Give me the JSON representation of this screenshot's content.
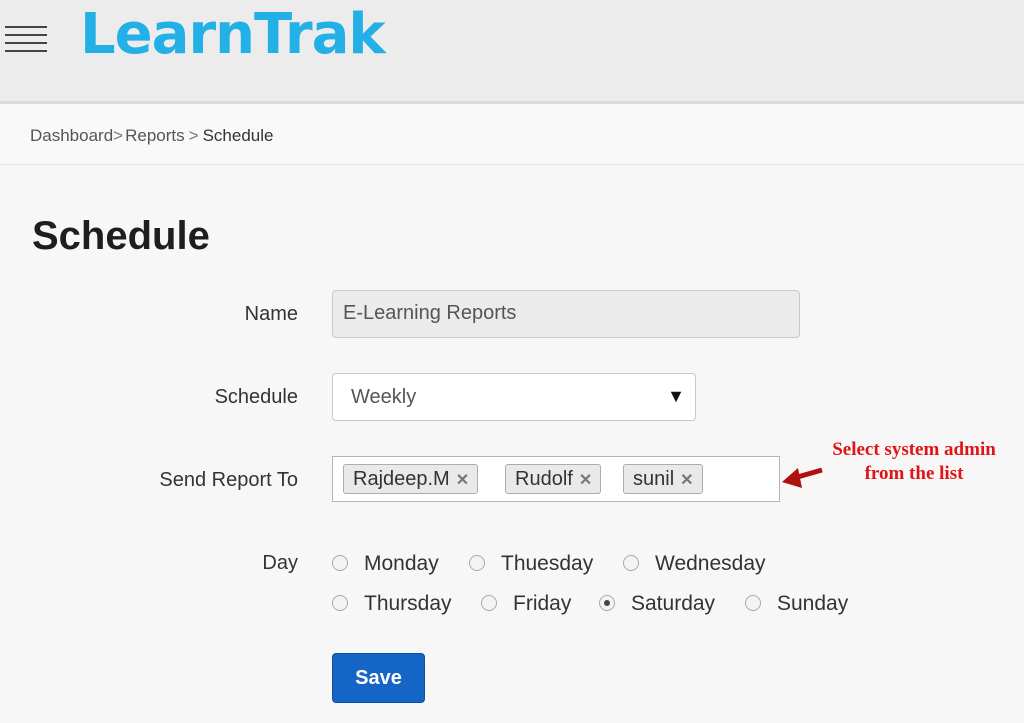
{
  "header": {
    "logo_text": "LearnTrak",
    "menu_icon": "hamburger-menu-icon"
  },
  "breadcrumb": {
    "items": [
      "Dashboard",
      "Reports",
      "Schedule"
    ],
    "separator": ">"
  },
  "page": {
    "title": "Schedule"
  },
  "form": {
    "name_label": "Name",
    "name_value": "E-Learning Reports",
    "schedule_label": "Schedule",
    "schedule_value": "Weekly",
    "send_to_label": "Send Report To",
    "recipients": [
      "Rajdeep.M",
      "Rudolf",
      "sunil"
    ],
    "remove_symbol": "✕",
    "day_label": "Day",
    "days": [
      "Monday",
      "Thuesday",
      "Wednesday",
      "Thursday",
      "Friday",
      "Saturday",
      "Sunday"
    ],
    "selected_day": "Saturday",
    "save_label": "Save"
  },
  "annotation": {
    "text_line1": "Select system admin",
    "text_line2": "from the list",
    "color": "#e01414"
  },
  "colors": {
    "brand": "#22b0e6",
    "primary_button": "#1565c7"
  }
}
